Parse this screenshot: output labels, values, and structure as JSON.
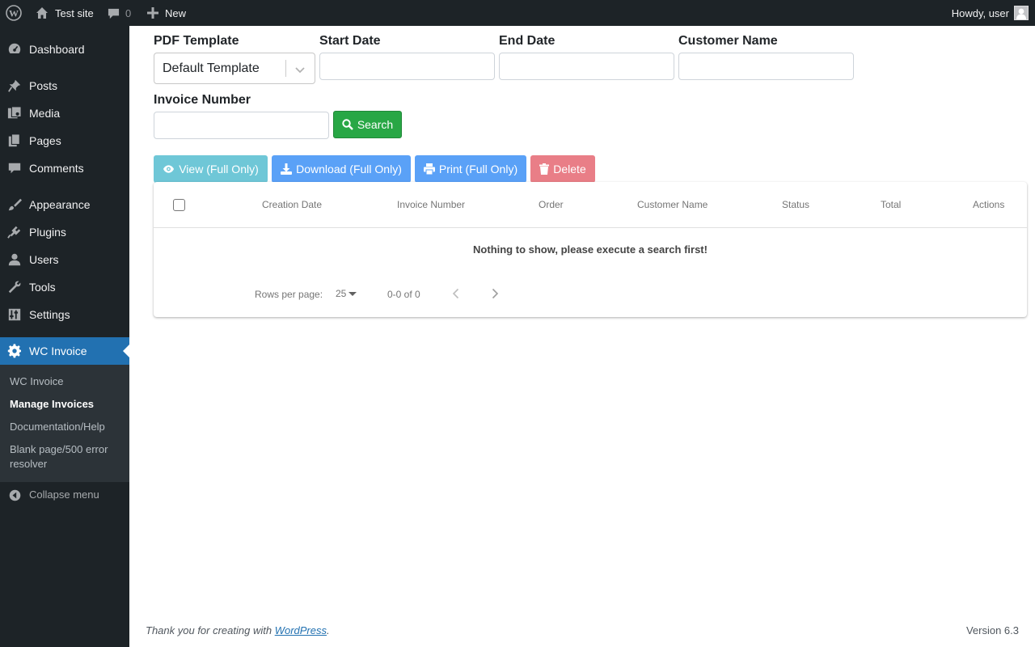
{
  "adminbar": {
    "site_name": "Test site",
    "comments_count": "0",
    "new_label": "New",
    "howdy": "Howdy, user"
  },
  "sidebar": {
    "items": [
      {
        "label": "Dashboard",
        "icon": "dashboard-icon"
      },
      {
        "label": "Posts",
        "icon": "pushpin-icon"
      },
      {
        "label": "Media",
        "icon": "media-icon"
      },
      {
        "label": "Pages",
        "icon": "pages-icon"
      },
      {
        "label": "Comments",
        "icon": "comment-icon"
      },
      {
        "label": "Appearance",
        "icon": "paintbrush-icon"
      },
      {
        "label": "Plugins",
        "icon": "plugin-icon"
      },
      {
        "label": "Users",
        "icon": "user-icon"
      },
      {
        "label": "Tools",
        "icon": "wrench-icon"
      },
      {
        "label": "Settings",
        "icon": "settings-icon"
      },
      {
        "label": "WC Invoice",
        "icon": "gear-icon"
      }
    ],
    "submenu": [
      {
        "label": "WC Invoice"
      },
      {
        "label": "Manage Invoices"
      },
      {
        "label": "Documentation/Help"
      },
      {
        "label": "Blank page/500 error resolver"
      }
    ],
    "collapse_label": "Collapse menu"
  },
  "filters": {
    "pdf_template_label": "PDF Template",
    "pdf_template_value": "Default Template",
    "start_date_label": "Start Date",
    "start_date_value": "",
    "end_date_label": "End Date",
    "end_date_value": "",
    "customer_name_label": "Customer Name",
    "customer_name_value": "",
    "invoice_number_label": "Invoice Number",
    "invoice_number_value": "",
    "search_label": "Search"
  },
  "actions": {
    "view_label": "View (Full Only)",
    "download_label": "Download (Full Only)",
    "print_label": "Print (Full Only)",
    "delete_label": "Delete"
  },
  "table": {
    "columns": [
      "Creation Date",
      "Invoice Number",
      "Order",
      "Customer Name",
      "Status",
      "Total",
      "Actions"
    ],
    "empty_message": "Nothing to show, please execute a search first!",
    "rows_per_page_label": "Rows per page:",
    "rows_per_page_value": "25",
    "range_text": "0-0 of 0"
  },
  "footer": {
    "thanks_prefix": "Thank you for creating with ",
    "thanks_link": "WordPress",
    "thanks_suffix": ".",
    "version": "Version 6.3"
  },
  "colors": {
    "adminbar_bg": "#1d2327",
    "current_menu_bg": "#2271b1",
    "search_button": "#28a745",
    "view_button": "#6fc7d7",
    "download_button": "#5aa1f7",
    "print_button": "#5aa1f7",
    "delete_button": "#e97e87"
  }
}
